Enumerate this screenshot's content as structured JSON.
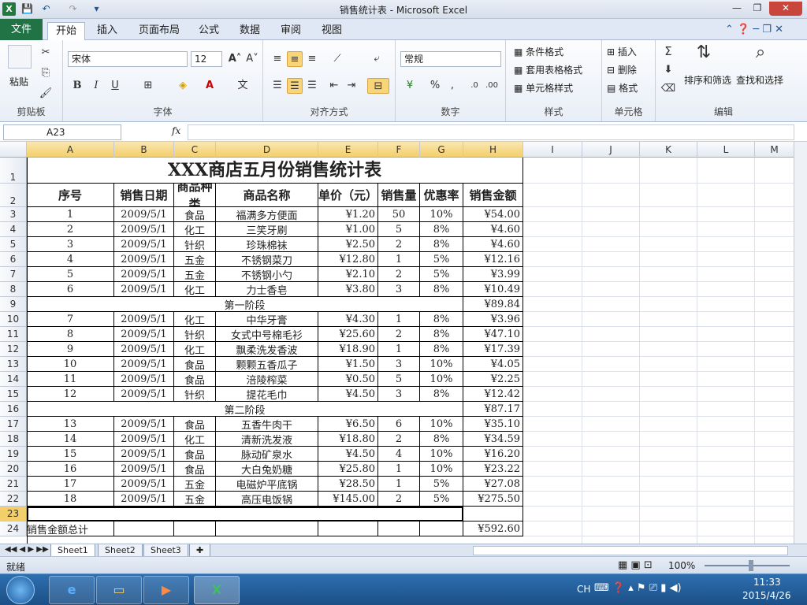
{
  "window": {
    "title": "销售统计表 - Microsoft Excel",
    "minimize": "—",
    "restore": "❐",
    "close": "✕"
  },
  "quick_access": {
    "excel_icon": "X",
    "save": "💾",
    "undo": "↶",
    "redo": "↷",
    "customize": "▾"
  },
  "tabs": {
    "file": "文件",
    "items": [
      "开始",
      "插入",
      "页面布局",
      "公式",
      "数据",
      "审阅",
      "视图"
    ]
  },
  "ribbon": {
    "clipboard": {
      "paste": "粘贴",
      "label": "剪贴板"
    },
    "font": {
      "name": "宋体",
      "size": "12",
      "bold": "B",
      "italic": "I",
      "underline": "U",
      "label": "字体"
    },
    "alignment": {
      "label": "对齐方式"
    },
    "number": {
      "format": "常规",
      "percent": "%",
      "comma": ",",
      "label": "数字"
    },
    "styles": {
      "conditional": "条件格式",
      "table": "套用表格格式",
      "cell_styles": "单元格样式",
      "label": "样式"
    },
    "cells": {
      "insert": "插入",
      "delete": "删除",
      "format": "格式",
      "label": "单元格"
    },
    "editing": {
      "sum": "Σ",
      "sort": "排序和筛选",
      "find": "查找和选择",
      "label": "编辑"
    }
  },
  "formula_bar": {
    "name_box": "A23",
    "fx": "fx",
    "content": ""
  },
  "columns": [
    "A",
    "B",
    "C",
    "D",
    "E",
    "F",
    "G",
    "H",
    "I",
    "J",
    "K",
    "L",
    "M"
  ],
  "sheet": {
    "title": "XXX商店五月份销售统计表",
    "headers": [
      "序号",
      "销售日期",
      "商品种类",
      "商品名称",
      "单价（元）",
      "销售量",
      "优惠率",
      "销售金额"
    ],
    "rows": [
      {
        "r": "3",
        "cells": [
          "1",
          "2009/5/1",
          "食品",
          "福满多方便面",
          "¥1.20",
          "50",
          "10%",
          "¥54.00"
        ]
      },
      {
        "r": "4",
        "cells": [
          "2",
          "2009/5/1",
          "化工",
          "三笑牙刷",
          "¥1.00",
          "5",
          "8%",
          "¥4.60"
        ]
      },
      {
        "r": "5",
        "cells": [
          "3",
          "2009/5/1",
          "针织",
          "珍珠棉袜",
          "¥2.50",
          "2",
          "8%",
          "¥4.60"
        ]
      },
      {
        "r": "6",
        "cells": [
          "4",
          "2009/5/1",
          "五金",
          "不锈钢菜刀",
          "¥12.80",
          "1",
          "5%",
          "¥12.16"
        ]
      },
      {
        "r": "7",
        "cells": [
          "5",
          "2009/5/1",
          "五金",
          "不锈钢小勺",
          "¥2.10",
          "2",
          "5%",
          "¥3.99"
        ]
      },
      {
        "r": "8",
        "cells": [
          "6",
          "2009/5/1",
          "化工",
          "力士香皂",
          "¥3.80",
          "3",
          "8%",
          "¥10.49"
        ]
      },
      {
        "r": "9",
        "stage": "第一阶段",
        "total": "¥89.84"
      },
      {
        "r": "10",
        "cells": [
          "7",
          "2009/5/1",
          "化工",
          "中华牙膏",
          "¥4.30",
          "1",
          "8%",
          "¥3.96"
        ]
      },
      {
        "r": "11",
        "cells": [
          "8",
          "2009/5/1",
          "针织",
          "女式中号棉毛衫",
          "¥25.60",
          "2",
          "8%",
          "¥47.10"
        ]
      },
      {
        "r": "12",
        "cells": [
          "9",
          "2009/5/1",
          "化工",
          "飘柔洗发香波",
          "¥18.90",
          "1",
          "8%",
          "¥17.39"
        ]
      },
      {
        "r": "13",
        "cells": [
          "10",
          "2009/5/1",
          "食品",
          "颗颗五香瓜子",
          "¥1.50",
          "3",
          "10%",
          "¥4.05"
        ]
      },
      {
        "r": "14",
        "cells": [
          "11",
          "2009/5/1",
          "食品",
          "涪陵榨菜",
          "¥0.50",
          "5",
          "10%",
          "¥2.25"
        ]
      },
      {
        "r": "15",
        "cells": [
          "12",
          "2009/5/1",
          "针织",
          "提花毛巾",
          "¥4.50",
          "3",
          "8%",
          "¥12.42"
        ]
      },
      {
        "r": "16",
        "stage": "第二阶段",
        "total": "¥87.17"
      },
      {
        "r": "17",
        "cells": [
          "13",
          "2009/5/1",
          "食品",
          "五香牛肉干",
          "¥6.50",
          "6",
          "10%",
          "¥35.10"
        ]
      },
      {
        "r": "18",
        "cells": [
          "14",
          "2009/5/1",
          "化工",
          "清新洗发液",
          "¥18.80",
          "2",
          "8%",
          "¥34.59"
        ]
      },
      {
        "r": "19",
        "cells": [
          "15",
          "2009/5/1",
          "食品",
          "脉动矿泉水",
          "¥4.50",
          "4",
          "10%",
          "¥16.20"
        ]
      },
      {
        "r": "20",
        "cells": [
          "16",
          "2009/5/1",
          "食品",
          "大白兔奶糖",
          "¥25.80",
          "1",
          "10%",
          "¥23.22"
        ]
      },
      {
        "r": "21",
        "cells": [
          "17",
          "2009/5/1",
          "五金",
          "电磁炉平底锅",
          "¥28.50",
          "1",
          "5%",
          "¥27.08"
        ]
      },
      {
        "r": "22",
        "cells": [
          "18",
          "2009/5/1",
          "五金",
          "高压电饭锅",
          "¥145.00",
          "2",
          "5%",
          "¥275.50"
        ]
      },
      {
        "r": "23",
        "blank": true
      },
      {
        "r": "24",
        "partial": "销售金额总计",
        "total": "¥592.60"
      }
    ]
  },
  "sheet_tabs": [
    "Sheet1",
    "Sheet2",
    "Sheet3"
  ],
  "status": {
    "ready": "就绪",
    "zoom": "100%"
  },
  "taskbar": {
    "lang": "CH",
    "time": "11:33",
    "date": "2015/4/26"
  }
}
